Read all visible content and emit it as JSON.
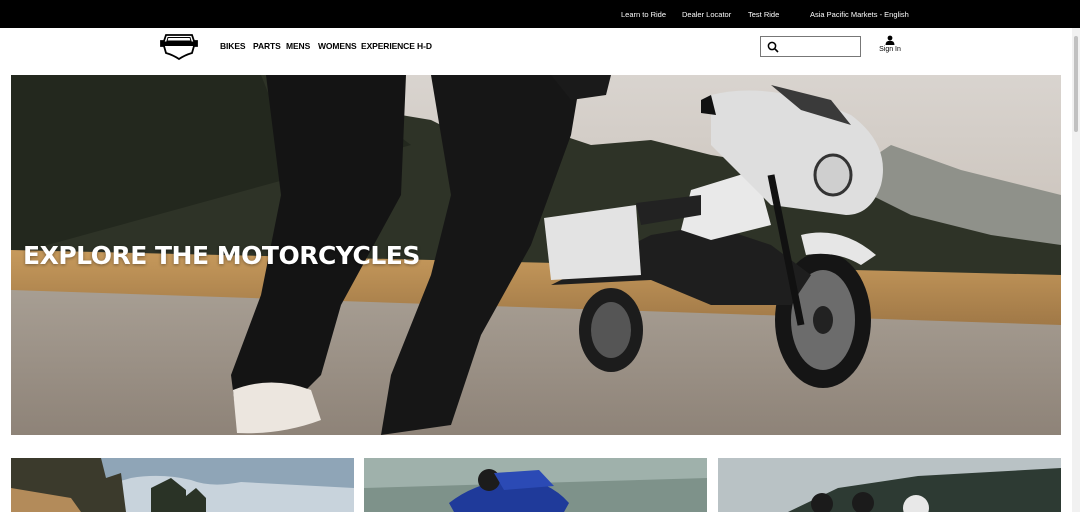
{
  "utility_nav": {
    "links": [
      "Learn to Ride",
      "Dealer Locator",
      "Test Ride"
    ],
    "region": "Asia Pacific Markets - English"
  },
  "main_nav": {
    "items": [
      "BIKES",
      "PARTS",
      "MENS",
      "WOMENS",
      "EXPERIENCE H-D"
    ]
  },
  "search": {
    "value": ""
  },
  "account": {
    "sign_in_label": "Sign In"
  },
  "hero": {
    "title": "EXPLORE THE MOTORCYCLES"
  },
  "icons": {
    "logo": "harley-davidson-shield-logo",
    "search": "search-icon",
    "user": "user-icon"
  },
  "colors": {
    "utility_bar": "#000000",
    "text": "#000000",
    "hero_text": "#ffffff"
  }
}
